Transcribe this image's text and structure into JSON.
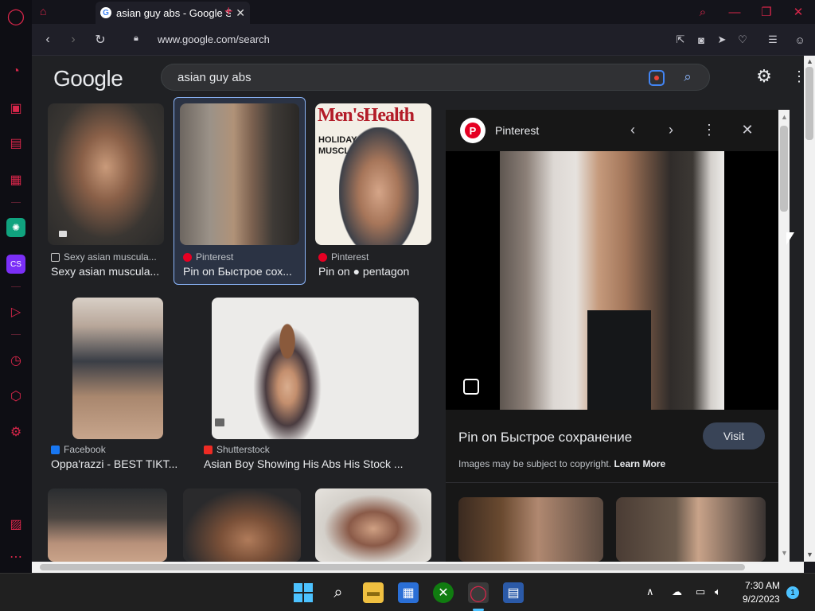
{
  "browser": {
    "tab_title": "asian guy abs - Google Sea",
    "tab_favicon": "G",
    "url": "www.google.com/search"
  },
  "search": {
    "query": "asian guy abs",
    "logo": "Google"
  },
  "results": [
    {
      "source": "Sexy asian muscula...",
      "title": "Sexy asian muscula...",
      "source_icon_color": "#ffffff"
    },
    {
      "source": "Pinterest",
      "title": "Pin on Быстрое сох...",
      "source_icon_color": "#e60023"
    },
    {
      "source": "Pinterest",
      "title": "Pin on ● pentagon",
      "source_icon_color": "#e60023"
    },
    {
      "source": "Facebook",
      "title": "Oppa'razzi - BEST TIKT...",
      "source_icon_color": "#1877f2"
    },
    {
      "source": "Shutterstock",
      "title": "Asian Boy Showing His Abs His Stock ...",
      "source_icon_color": "#ee2b24"
    }
  ],
  "magazine": {
    "masthead": "Men'sHealth",
    "line1": "HOLIDAY",
    "line2": "MUSCLE"
  },
  "panel": {
    "source": "Pinterest",
    "title": "Pin on Быстрое сохранение",
    "visit_label": "Visit",
    "copyright_text": "Images may be subject to copyright.",
    "learn_more": "Learn More"
  },
  "taskbar": {
    "time": "7:30 AM",
    "date": "9/2/2023",
    "notification_count": "1"
  },
  "colors": {
    "opera_red": "#d8264a",
    "link_blue": "#8ab4f8",
    "page_bg": "#202124"
  }
}
